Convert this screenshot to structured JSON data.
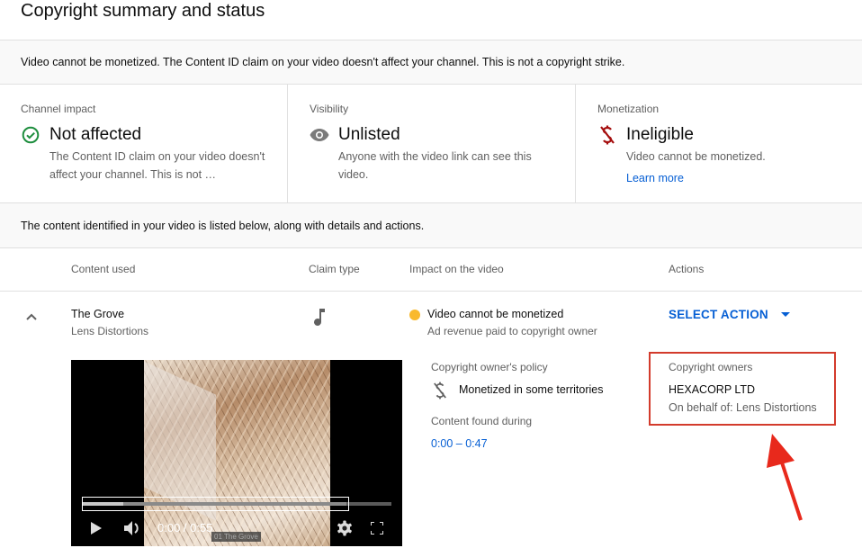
{
  "page": {
    "title": "Copyright summary and status"
  },
  "summary_banner": "Video cannot be monetized. The Content ID claim on your video doesn't affect your channel. This is not a copyright strike.",
  "cards": [
    {
      "label": "Channel impact",
      "value": "Not affected",
      "icon": "check-circle-icon",
      "icon_color": "#1e8e3e",
      "description": "The Content ID claim on your video doesn't affect your channel. This is not …"
    },
    {
      "label": "Visibility",
      "value": "Unlisted",
      "icon": "eye-icon",
      "icon_color": "#606060",
      "description": "Anyone with the video link can see this video."
    },
    {
      "label": "Monetization",
      "value": "Ineligible",
      "icon": "dollar-off-icon",
      "icon_color": "#a50e0e",
      "description": "Video cannot be monetized.",
      "link": "Learn more"
    }
  ],
  "content_banner": "The content identified in your video is listed below, along with details and actions.",
  "table": {
    "headers": [
      "Content used",
      "Claim type",
      "Impact on the video",
      "Actions"
    ],
    "rows": [
      {
        "title": "The Grove",
        "artist": "Lens Distortions",
        "claim_type": "music-note-icon",
        "impact_title": "Video cannot be monetized",
        "impact_sub": "Ad revenue paid to copyright owner",
        "impact_color": "#f9b92d",
        "action": "SELECT ACTION",
        "expanded": true,
        "details": {
          "policy_label": "Copyright owner's policy",
          "policy_value": "Monetized in some territories",
          "found_label": "Content found during",
          "found_value": "0:00 – 0:47",
          "owners_label": "Copyright owners",
          "owners_name": "HEXACORP LTD",
          "owners_sub": "On behalf of: Lens Distortions"
        },
        "player": {
          "time": "0:00 / 0:55",
          "caption": "01 The Grove",
          "played_fraction": 0.13,
          "highlight_fraction": 0.855
        }
      }
    ]
  },
  "colors": {
    "accent": "#065fd4",
    "annotation": "#d33b2c",
    "arrow": "#e8291c"
  }
}
